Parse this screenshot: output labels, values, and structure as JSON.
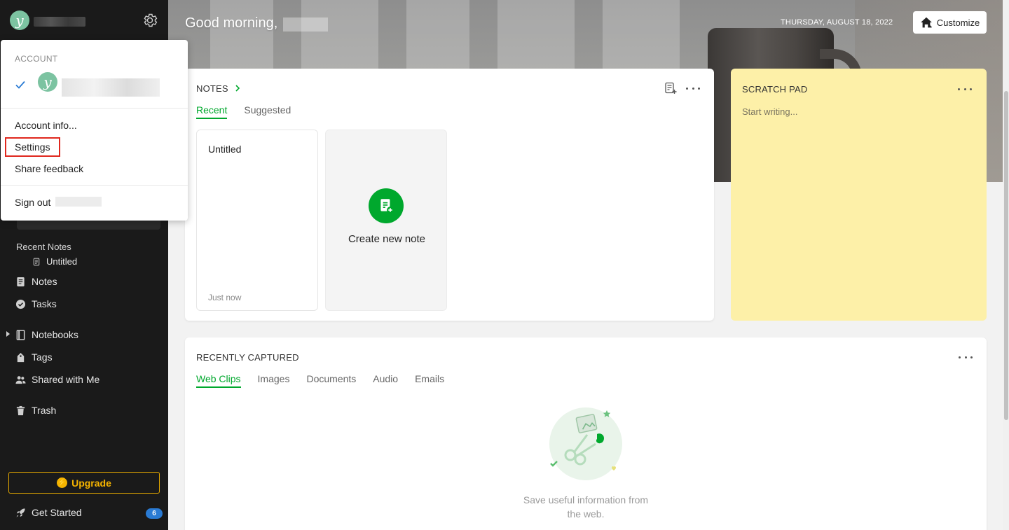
{
  "sidebar": {
    "recent_notes_label": "Recent Notes",
    "recent_note": "Untitled",
    "items": [
      {
        "label": "Notes"
      },
      {
        "label": "Tasks"
      },
      {
        "label": "Notebooks"
      },
      {
        "label": "Tags"
      },
      {
        "label": "Shared with Me"
      },
      {
        "label": "Trash"
      }
    ],
    "upgrade_label": "Upgrade",
    "get_started_label": "Get Started",
    "get_started_badge": "6"
  },
  "header": {
    "greeting": "Good morning,",
    "date": "THURSDAY, AUGUST 18, 2022",
    "customize_label": "Customize"
  },
  "notes_card": {
    "title": "NOTES",
    "tabs": [
      "Recent",
      "Suggested"
    ],
    "note": {
      "title": "Untitled",
      "time": "Just now"
    },
    "create_label": "Create new note"
  },
  "scratch_pad": {
    "title": "SCRATCH PAD",
    "placeholder": "Start writing..."
  },
  "recently_captured": {
    "title": "RECENTLY CAPTURED",
    "tabs": [
      "Web Clips",
      "Images",
      "Documents",
      "Audio",
      "Emails"
    ],
    "empty_line1": "Save useful information from",
    "empty_line2": "the web."
  },
  "account_menu": {
    "section_label": "ACCOUNT",
    "avatar_letter": "y",
    "items": {
      "account_info": "Account info...",
      "settings": "Settings",
      "share_feedback": "Share feedback",
      "sign_out": "Sign out"
    }
  },
  "colors": {
    "accent_green": "#00a82d",
    "upgrade_yellow": "#f5b400",
    "sidebar_bg": "#1a1a1a",
    "scratch_bg": "#fdf0a8",
    "highlight_red": "#e0281e"
  }
}
